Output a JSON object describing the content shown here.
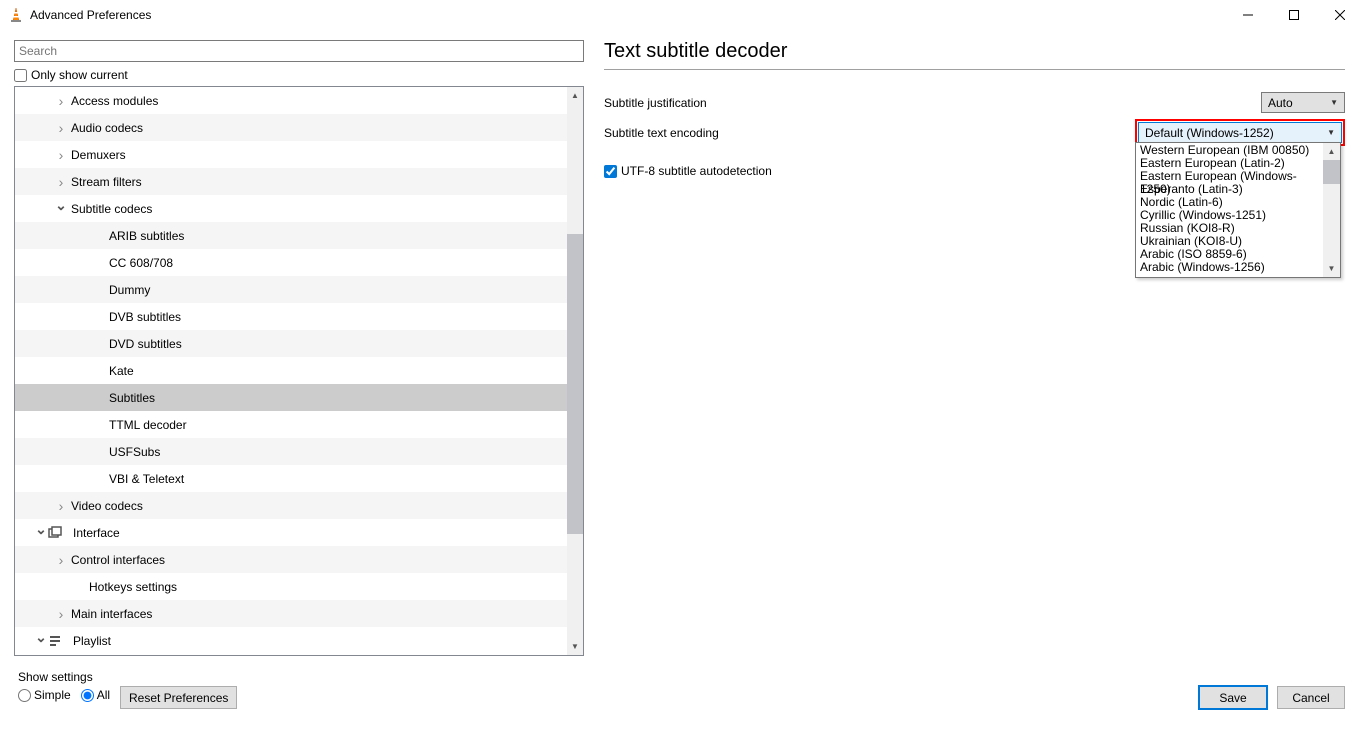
{
  "window": {
    "title": "Advanced Preferences"
  },
  "search": {
    "placeholder": "Search"
  },
  "only_show_current": "Only show current",
  "tree": [
    {
      "indent": 40,
      "chev": "right",
      "label": "Access modules"
    },
    {
      "indent": 40,
      "chev": "right",
      "label": "Audio codecs"
    },
    {
      "indent": 40,
      "chev": "right",
      "label": "Demuxers"
    },
    {
      "indent": 40,
      "chev": "right",
      "label": "Stream filters"
    },
    {
      "indent": 40,
      "chev": "down",
      "label": "Subtitle codecs"
    },
    {
      "indent": 78,
      "chev": "",
      "label": "ARIB subtitles"
    },
    {
      "indent": 78,
      "chev": "",
      "label": "CC 608/708"
    },
    {
      "indent": 78,
      "chev": "",
      "label": "Dummy"
    },
    {
      "indent": 78,
      "chev": "",
      "label": "DVB subtitles"
    },
    {
      "indent": 78,
      "chev": "",
      "label": "DVD subtitles"
    },
    {
      "indent": 78,
      "chev": "",
      "label": "Kate"
    },
    {
      "indent": 78,
      "chev": "",
      "label": "Subtitles",
      "selected": true
    },
    {
      "indent": 78,
      "chev": "",
      "label": "TTML decoder"
    },
    {
      "indent": 78,
      "chev": "",
      "label": "USFSubs"
    },
    {
      "indent": 78,
      "chev": "",
      "label": "VBI & Teletext"
    },
    {
      "indent": 40,
      "chev": "right",
      "label": "Video codecs"
    },
    {
      "indent": 20,
      "chev": "down",
      "label": "Interface",
      "icon": "interface"
    },
    {
      "indent": 40,
      "chev": "right",
      "label": "Control interfaces"
    },
    {
      "indent": 58,
      "chev": "",
      "label": "Hotkeys settings"
    },
    {
      "indent": 40,
      "chev": "right",
      "label": "Main interfaces"
    },
    {
      "indent": 20,
      "chev": "down",
      "label": "Playlist",
      "icon": "playlist"
    }
  ],
  "panel": {
    "title": "Text subtitle decoder",
    "justification": {
      "label": "Subtitle justification",
      "value": "Auto"
    },
    "encoding": {
      "label": "Subtitle text encoding",
      "value": "Default (Windows-1252)"
    },
    "utf8": {
      "label": "UTF-8 subtitle autodetection",
      "checked": true
    }
  },
  "encoding_options": [
    "Western European (IBM 00850)",
    "Eastern European (Latin-2)",
    "Eastern European (Windows-1250)",
    "Esperanto (Latin-3)",
    "Nordic (Latin-6)",
    "Cyrillic (Windows-1251)",
    "Russian (KOI8-R)",
    "Ukrainian (KOI8-U)",
    "Arabic (ISO 8859-6)",
    "Arabic (Windows-1256)"
  ],
  "footer": {
    "show_settings": "Show settings",
    "simple": "Simple",
    "all": "All",
    "reset": "Reset Preferences",
    "save": "Save",
    "cancel": "Cancel"
  }
}
